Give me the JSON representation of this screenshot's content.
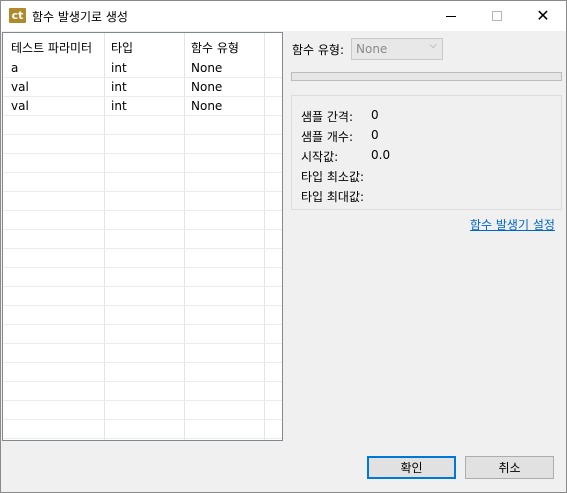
{
  "window": {
    "title": "함수 발생기로 생성",
    "icon_text": "ct",
    "close_glyph": "✕"
  },
  "table": {
    "headers": [
      "테스트 파라미터",
      "타입",
      "함수 유형"
    ],
    "rows": [
      {
        "param": "a",
        "type": "int",
        "func": "None"
      },
      {
        "param": "val",
        "type": "int",
        "func": "None"
      },
      {
        "param": "val",
        "type": "int",
        "func": "None"
      }
    ],
    "empty_rows": 17
  },
  "right": {
    "function_type_label": "함수 유형:",
    "function_type_value": "None",
    "progress_fraction": 0,
    "info": [
      {
        "label": "샘플 간격:",
        "value": "0"
      },
      {
        "label": "샘플 개수:",
        "value": "0"
      },
      {
        "label": "시작값:",
        "value": "0.0"
      },
      {
        "label": "타입 최소값:",
        "value": ""
      },
      {
        "label": "타입 최대값:",
        "value": ""
      }
    ],
    "settings_link": "함수 발생기 설정"
  },
  "buttons": {
    "ok": "확인",
    "cancel": "취소"
  },
  "colors": {
    "link": "#0066cc",
    "icon_bg": "#b08a2a",
    "focus_border": "#0078d7"
  }
}
